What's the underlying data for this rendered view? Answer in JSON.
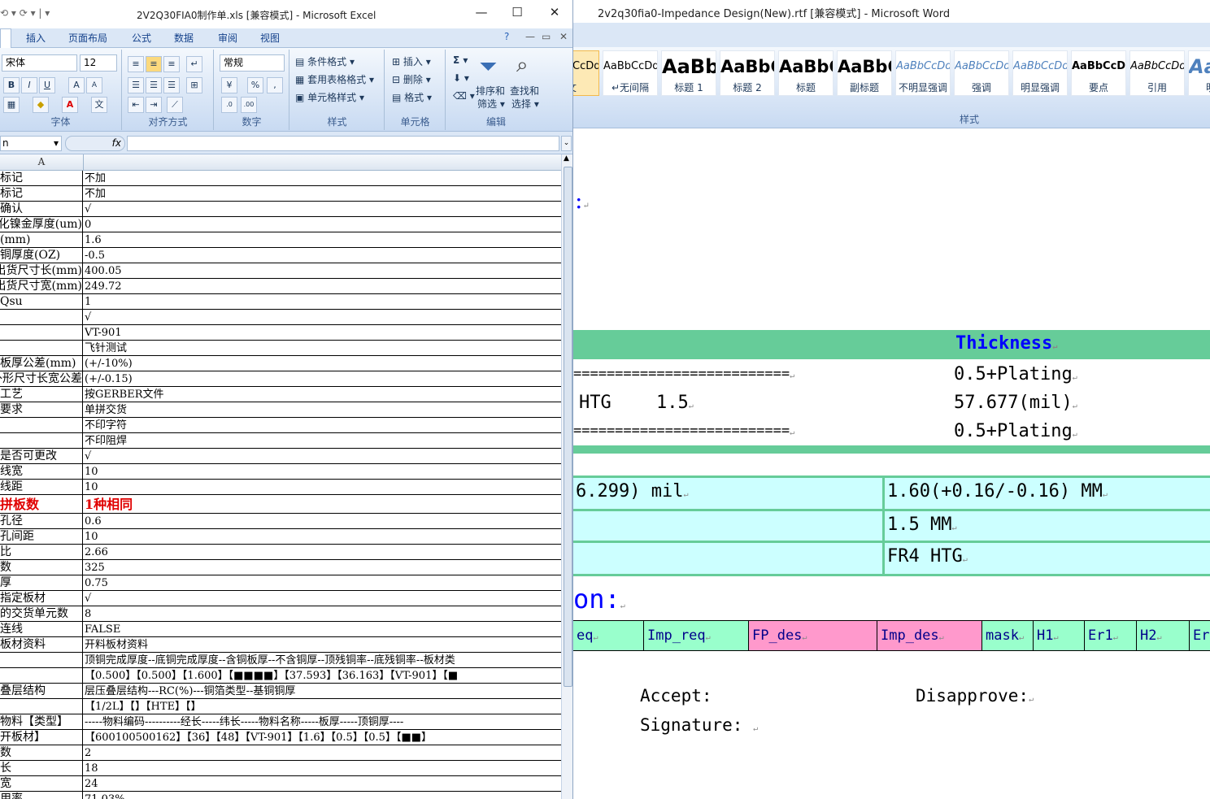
{
  "excel": {
    "title": "2V2Q30FIA0制作单.xls  [兼容模式] - Microsoft Excel",
    "tabs": [
      "插入",
      "页面布局",
      "公式",
      "数据",
      "审阅",
      "视图"
    ],
    "font": {
      "name": "宋体",
      "size": "12"
    },
    "number_format": "常规",
    "groups": [
      "字体",
      "对齐方式",
      "数字",
      "样式",
      "单元格",
      "编辑"
    ],
    "style_buttons": [
      "条件格式",
      "套用表格格式",
      "单元格样式"
    ],
    "cell_buttons": [
      "插入",
      "删除",
      "格式"
    ],
    "edit_buttons": {
      "sort": "排序和\n筛选",
      "find": "查找和\n选择"
    },
    "sort_label_1": "排序和",
    "sort_label_2": "筛选",
    "find_label_1": "查找和",
    "find_label_2": "选择",
    "fx": "fx",
    "name_box": "n",
    "column_header": "A",
    "rows": [
      {
        "a": "标记",
        "b": "不加"
      },
      {
        "a": "标记",
        "b": "不加"
      },
      {
        "a": "确认",
        "b": "√"
      },
      {
        "a": "化镍金厚度(um)",
        "b": "0"
      },
      {
        "a": "(mm)",
        "b": "1.6"
      },
      {
        "a": "铜厚度(OZ)",
        "b": "-0.5"
      },
      {
        "a": "出货尺寸长(mm)",
        "b": "400.05"
      },
      {
        "a": "出货尺寸宽(mm)",
        "b": "249.72"
      },
      {
        "a": "Qsu",
        "b": "1"
      },
      {
        "a": "",
        "b": "√"
      },
      {
        "a": "",
        "b": "VT-901"
      },
      {
        "a": "",
        "b": "飞针测试"
      },
      {
        "a": "板厚公差(mm)",
        "b": "(+/-10%)"
      },
      {
        "a": "外形尺寸长宽公差",
        "b": "(+/-0.15)"
      },
      {
        "a": "工艺",
        "b": "按GERBER文件"
      },
      {
        "a": "要求",
        "b": "单拼交货"
      },
      {
        "a": "",
        "b": "不印字符"
      },
      {
        "a": "",
        "b": "不印阻焊"
      },
      {
        "a": "是否可更改",
        "b": "√"
      },
      {
        "a": "线宽",
        "b": "10"
      },
      {
        "a": "线距",
        "b": "10"
      },
      {
        "a": "拼板数",
        "b": "1种相同",
        "red": true
      },
      {
        "a": "孔径",
        "b": "0.6"
      },
      {
        "a": "孔间距",
        "b": "10"
      },
      {
        "a": "比",
        "b": "2.66"
      },
      {
        "a": "数",
        "b": "325"
      },
      {
        "a": "厚",
        "b": "0.75"
      },
      {
        "a": "指定板材",
        "b": "√"
      },
      {
        "a": "的交货单元数",
        "b": "8"
      },
      {
        "a": "连线",
        "b": "FALSE"
      },
      {
        "a": "板材资料",
        "b": "开料板材资料"
      },
      {
        "a": "",
        "b": "顶铜完成厚度--底铜完成厚度--含铜板厚--不含铜厚--顶残铜率--底残铜率--板材类"
      },
      {
        "a": "",
        "b": "【0.500】【0.500】【1.600】【■■■■】【37.593】【36.163】【VT-901】【■"
      },
      {
        "a": "叠层结构",
        "b": "层压叠层结构---RC(%)---铜箔类型--基铜铜厚"
      },
      {
        "a": "",
        "b": "【1/2L】【】【HTE】【】"
      },
      {
        "a": "物料【类型】",
        "b": "-----物料编码----------经长-----纬长-----物料名称-----板厚-----顶铜厚----"
      },
      {
        "a": "开板材】",
        "b": "【600100500162】【36】【48】【VT-901】【1.6】【0.5】【0.5】【■■】"
      },
      {
        "a": "数",
        "b": "2"
      },
      {
        "a": "长",
        "b": "18"
      },
      {
        "a": "宽",
        "b": "24"
      },
      {
        "a": "用率",
        "b": "71.03%"
      }
    ]
  },
  "word": {
    "title": "2v2q30fia0-Impedance Design(New).rtf [兼容模式] - Microsoft Word",
    "styles_group": "样式",
    "styles": [
      {
        "preview": "AaBbCcDd",
        "name": "文"
      },
      {
        "preview": "AaBbCcDd",
        "name": "↵无间隔"
      },
      {
        "preview": "AaBb",
        "name": "标题 1"
      },
      {
        "preview": "AaBbC",
        "name": "标题 2"
      },
      {
        "preview": "AaBbC",
        "name": "标题"
      },
      {
        "preview": "AaBbC",
        "name": "副标题"
      },
      {
        "preview": "AaBbCcDd",
        "name": "不明显强调"
      },
      {
        "preview": "AaBbCcDd",
        "name": "强调"
      },
      {
        "preview": "AaBbCcDd",
        "name": "明显强调"
      },
      {
        "preview": "AaBbCcDd",
        "name": "要点"
      },
      {
        "preview": "AaBbCcDd",
        "name": "引用"
      },
      {
        "preview": "AaBb",
        "name": "明显"
      }
    ],
    "doc": {
      "colon": ":",
      "thickness_header": "Thickness",
      "eq_line": "==========================",
      "htg_label": "HTG",
      "htg_value": "1.5",
      "plating_1": "0.5+Plating",
      "mil_value": "57.677(mil)",
      "plating_2": "0.5+Plating",
      "cell_mil": "6.299) mil",
      "cell_thick": "1.60(+0.16/-0.16) MM",
      "cell_mm": "1.5 MM",
      "cell_material": "FR4 HTG",
      "section_title": "on:",
      "headers": [
        "eq",
        "Imp_req",
        "FP_des",
        "Imp_des",
        "mask",
        "H1",
        "Er1",
        "H2",
        "Er"
      ],
      "accept": "Accept:",
      "disapprove": "Disapprove:",
      "signature": "Signature:"
    }
  }
}
